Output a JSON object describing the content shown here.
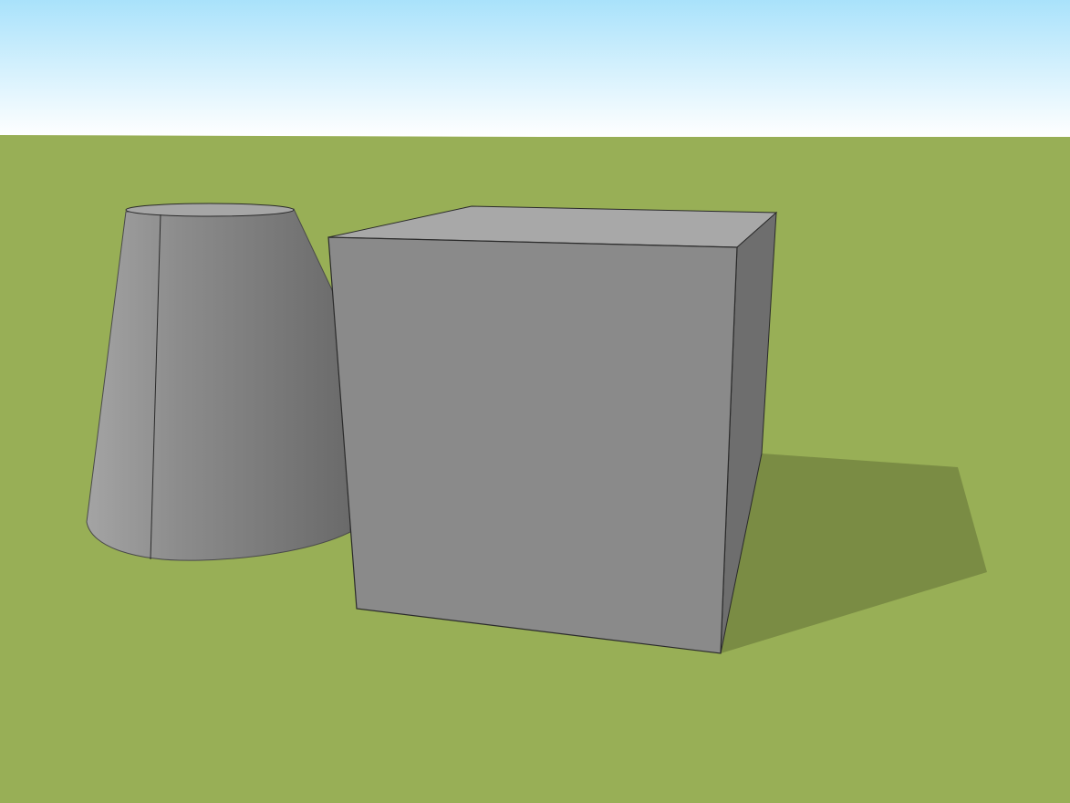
{
  "viewport": {
    "sky_top_color": "#a9e2fb",
    "sky_horizon_color": "#ffffff",
    "ground_color": "#98af56",
    "shadow_color": "#7a8c44",
    "edge_color": "#2a2a2a",
    "background_edge_color": "#4a4a4a"
  },
  "objects": [
    {
      "name": "cube",
      "front_face_color": "#8a8a8a",
      "top_face_color": "#a8a8a8",
      "side_face_color": "#6e6e6e"
    },
    {
      "name": "truncated-cone",
      "light_side_color": "#a4a4a4",
      "mid_color": "#8c8c8c",
      "dark_side_color": "#6a6a6a",
      "top_cap_color": "#a6a6a6"
    }
  ]
}
